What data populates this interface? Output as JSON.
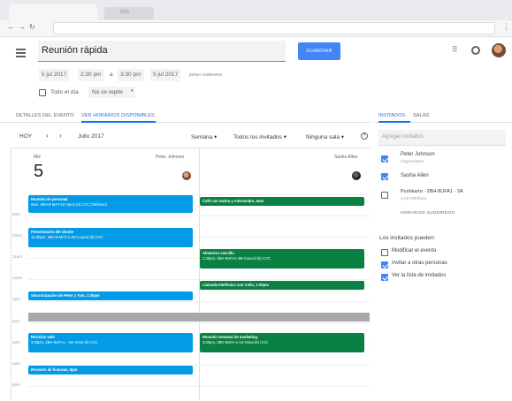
{
  "browser": {
    "tab_title": "",
    "tab2_title": "Nilo"
  },
  "header": {
    "title_value": "Reunión rápida",
    "save_label": "GUARDAR",
    "grid_icon": "apps-grid-icon",
    "settings_icon": "settings-icon"
  },
  "datetime": {
    "start_date": "5 jul 2017",
    "start_time": "2:30 pm",
    "sep": "a",
    "end_time": "3:30 pm",
    "end_date": "5 jul 2017",
    "timezone": "ZONA HORARIA",
    "all_day": "Todo el día",
    "repeat": "No se repite"
  },
  "tabs": {
    "details": "DETALLES DEL EVENTO",
    "availability": "VER HORARIOS DISPONIBLES"
  },
  "guest_tabs": {
    "guests": "INVITADOS",
    "rooms": "SALAS"
  },
  "toolbar": {
    "today": "HOY",
    "month": "Julio 2017",
    "view": "Semana",
    "guests_filter": "Todos los invitados",
    "room_filter": "Ninguna sala"
  },
  "day": {
    "weekday": "Mié",
    "number": "5",
    "col1_name": "Peter Johnson",
    "col2_name": "Sasha Allen"
  },
  "time_labels": [
    "9am",
    "10am",
    "11am",
    "12pm",
    "1pm",
    "2pm",
    "3pm",
    "4pm",
    "5pm",
    "6pm"
  ],
  "events_left": [
    {
      "title": "Reunión de personal",
      "detail": "9am, 2BH-8-MAT-10-7pers (6) CVC (Teléfono)"
    },
    {
      "title": "Presentación del cliente",
      "detail": "12:30pm, 2BH-8-MAT-1-38-Council (6) CVC"
    },
    {
      "title": "Sincronización de Peter y Tom, 1:30pm",
      "detail": ""
    },
    {
      "title": "Revisión web",
      "detail": "3:30pm, 2BH-8UFA1 - 3m Tema (6) CVC"
    },
    {
      "title": "Revisión de finanzas, 6pm",
      "detail": ""
    }
  ],
  "events_right": [
    {
      "title": "Café con Sasha y Alessandro, 9am",
      "detail": ""
    },
    {
      "title": "Almuerzo sencillo",
      "detail": "1:30pm, 2BH-8UFA1-3B-Council (6) CVC"
    },
    {
      "title": "Llamada telefónica con Colin, 1:00pm",
      "detail": ""
    },
    {
      "title": "Reunión semanal de marketing",
      "detail": "3:30pm, 2BH-8UFA-1-14-Tema (6) CVC"
    }
  ],
  "guests": {
    "search_placeholder": "Agregar invitados",
    "list": [
      {
        "name": "Peter Johnson",
        "sub": "Organizador",
        "checked": true
      },
      {
        "name": "Sasha Allen",
        "sub": "",
        "checked": true
      },
      {
        "name": "Pushkarto · 2BH-8UFA1 - 3A",
        "sub": "4 (6) Teléfono",
        "checked": false
      }
    ],
    "suggest": "HORARIOS SUGERIDOS",
    "can_label": "Los invitados pueden:",
    "perms": [
      {
        "label": "Modificar el evento",
        "checked": false
      },
      {
        "label": "Invitar a otras personas",
        "checked": true
      },
      {
        "label": "Ver la lista de invitados",
        "checked": true
      }
    ]
  }
}
